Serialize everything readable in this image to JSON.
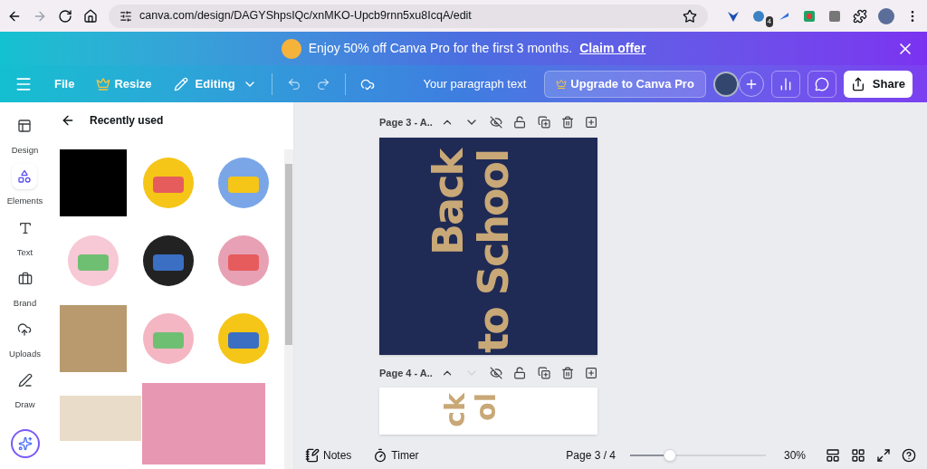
{
  "browser": {
    "url": "canva.com/design/DAGYShpsIQc/xnMKO-Upcb9rnn5xu8IcqA/edit",
    "forward_disabled": true,
    "extension_badge": "4"
  },
  "banner": {
    "text": "Enjoy 50% off Canva Pro for the first 3 months.",
    "link": "Claim offer"
  },
  "toolbar": {
    "file": "File",
    "resize": "Resize",
    "editing": "Editing",
    "title": "Your paragraph text",
    "upgrade": "Upgrade to Canva Pro",
    "share": "Share"
  },
  "sidebar": {
    "items": [
      {
        "label": "Design",
        "selected": false
      },
      {
        "label": "Elements",
        "selected": true
      },
      {
        "label": "Text",
        "selected": false
      },
      {
        "label": "Brand",
        "selected": false
      },
      {
        "label": "Uploads",
        "selected": false
      },
      {
        "label": "Draw",
        "selected": false
      }
    ]
  },
  "panel": {
    "title": "Recently used",
    "items": [
      {
        "kind": "square"
      },
      {
        "kind": "art"
      },
      {
        "kind": "art"
      },
      {
        "kind": "art"
      },
      {
        "kind": "art"
      },
      {
        "kind": "art"
      },
      {
        "kind": "texture"
      },
      {
        "kind": "art"
      },
      {
        "kind": "art"
      }
    ]
  },
  "pages": [
    {
      "label": "Page 3 - A..",
      "down_disabled": false,
      "lines": [
        "Back",
        "to School"
      ]
    },
    {
      "label": "Page 4 - A..",
      "down_disabled": true,
      "lines": [
        "ck",
        "ol"
      ]
    }
  ],
  "footer": {
    "notes": "Notes",
    "timer": "Timer",
    "page": "Page 3 / 4",
    "zoom": {
      "level": 0.29
    },
    "zoom_reading": "30%"
  }
}
